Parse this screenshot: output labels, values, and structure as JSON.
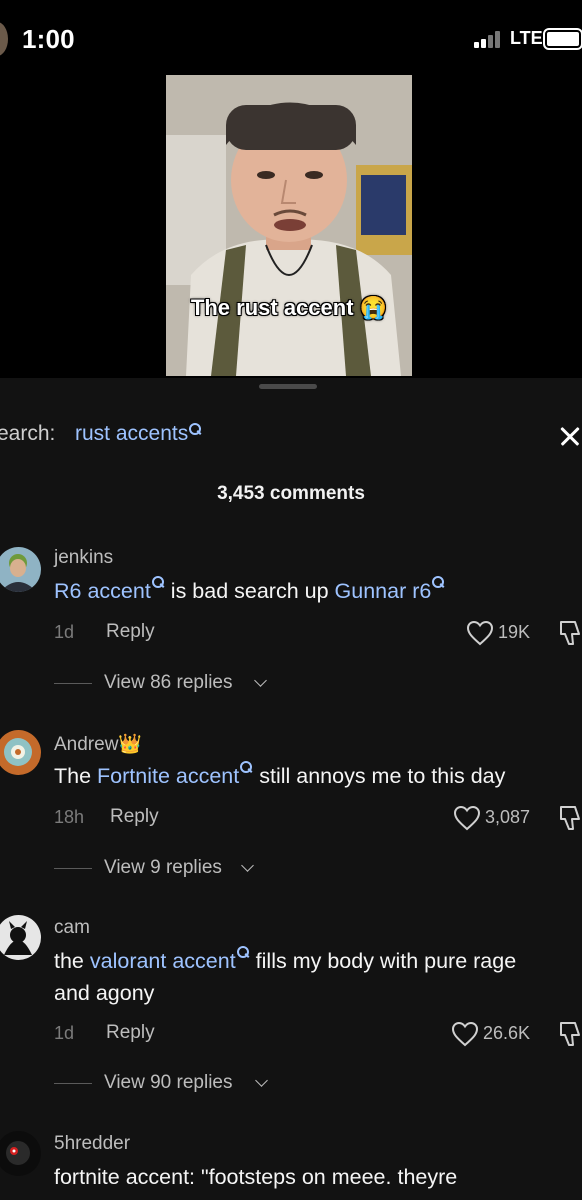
{
  "status_bar": {
    "time": "1:00",
    "network": "LTE"
  },
  "video": {
    "caption": "The rust accent",
    "caption_emoji": "😭"
  },
  "comments_panel": {
    "search_label": "earch:",
    "search_term": "rust accents",
    "comment_count": "3,453 comments"
  },
  "comments": [
    {
      "username": "jenkins",
      "text_segments": [
        {
          "text": "R6 accent",
          "link": true
        },
        {
          "text": " is bad search up ",
          "link": false
        },
        {
          "text": "Gunnar r6",
          "link": true
        }
      ],
      "time": "1d",
      "reply_label": "Reply",
      "likes": "19K",
      "view_replies": "View 86 replies"
    },
    {
      "username": "Andrew👑",
      "text_segments": [
        {
          "text": "The ",
          "link": false
        },
        {
          "text": "Fortnite accent",
          "link": true
        },
        {
          "text": " still annoys me to this day",
          "link": false
        }
      ],
      "time": "18h",
      "reply_label": "Reply",
      "likes": "3,087",
      "view_replies": "View 9 replies"
    },
    {
      "username": "cam",
      "text_segments": [
        {
          "text": "the ",
          "link": false
        },
        {
          "text": "valorant accent",
          "link": true
        },
        {
          "text": " fills my body with pure rage",
          "link": false
        }
      ],
      "text_line2": "and agony",
      "time": "1d",
      "reply_label": "Reply",
      "likes": "26.6K",
      "view_replies": "View 90 replies"
    },
    {
      "username": "5hredder",
      "text_line1": "fortnite accent: \"footsteps on meee. theyre"
    }
  ],
  "colors": {
    "link": "#9ec3ff",
    "sheet_bg": "#121212",
    "muted_text": "#bdbdbd"
  }
}
